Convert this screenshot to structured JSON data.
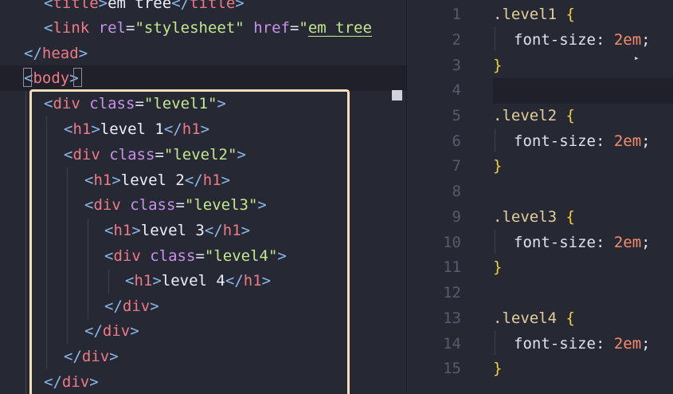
{
  "html_editor": {
    "lines": [
      [
        {
          "t": "<",
          "c": "punc"
        },
        {
          "t": "title",
          "c": "tag"
        },
        {
          "t": ">",
          "c": "punc"
        },
        {
          "t": "em tree",
          "c": "text"
        },
        {
          "t": "</",
          "c": "punc"
        },
        {
          "t": "title",
          "c": "tag"
        },
        {
          "t": ">",
          "c": "punc"
        }
      ],
      [
        {
          "t": "<",
          "c": "punc"
        },
        {
          "t": "link",
          "c": "tag"
        },
        {
          "t": " ",
          "c": "text"
        },
        {
          "t": "rel",
          "c": "attr"
        },
        {
          "t": "=",
          "c": "eq"
        },
        {
          "t": "\"stylesheet\"",
          "c": "str"
        },
        {
          "t": " ",
          "c": "text"
        },
        {
          "t": "href",
          "c": "attr"
        },
        {
          "t": "=",
          "c": "eq"
        },
        {
          "t": "\"",
          "c": "str"
        },
        {
          "t": "em_tree",
          "c": "str underline"
        }
      ],
      [
        {
          "t": "</",
          "c": "punc"
        },
        {
          "t": "head",
          "c": "tag"
        },
        {
          "t": ">",
          "c": "punc"
        }
      ],
      [
        {
          "t": "<",
          "c": "punc"
        },
        {
          "t": "body",
          "c": "tag"
        },
        {
          "t": ">",
          "c": "punc"
        }
      ],
      [
        {
          "t": "<",
          "c": "punc"
        },
        {
          "t": "div",
          "c": "tag"
        },
        {
          "t": " ",
          "c": "text"
        },
        {
          "t": "class",
          "c": "attr"
        },
        {
          "t": "=",
          "c": "eq"
        },
        {
          "t": "\"level1\"",
          "c": "str"
        },
        {
          "t": ">",
          "c": "punc"
        }
      ],
      [
        {
          "t": "<",
          "c": "punc"
        },
        {
          "t": "h1",
          "c": "tag"
        },
        {
          "t": ">",
          "c": "punc"
        },
        {
          "t": "level 1",
          "c": "text"
        },
        {
          "t": "</",
          "c": "punc"
        },
        {
          "t": "h1",
          "c": "tag"
        },
        {
          "t": ">",
          "c": "punc"
        }
      ],
      [
        {
          "t": "<",
          "c": "punc"
        },
        {
          "t": "div",
          "c": "tag"
        },
        {
          "t": " ",
          "c": "text"
        },
        {
          "t": "class",
          "c": "attr"
        },
        {
          "t": "=",
          "c": "eq"
        },
        {
          "t": "\"level2\"",
          "c": "str"
        },
        {
          "t": ">",
          "c": "punc"
        }
      ],
      [
        {
          "t": "<",
          "c": "punc"
        },
        {
          "t": "h1",
          "c": "tag"
        },
        {
          "t": ">",
          "c": "punc"
        },
        {
          "t": "level 2",
          "c": "text"
        },
        {
          "t": "</",
          "c": "punc"
        },
        {
          "t": "h1",
          "c": "tag"
        },
        {
          "t": ">",
          "c": "punc"
        }
      ],
      [
        {
          "t": "<",
          "c": "punc"
        },
        {
          "t": "div",
          "c": "tag"
        },
        {
          "t": " ",
          "c": "text"
        },
        {
          "t": "class",
          "c": "attr"
        },
        {
          "t": "=",
          "c": "eq"
        },
        {
          "t": "\"level3\"",
          "c": "str"
        },
        {
          "t": ">",
          "c": "punc"
        }
      ],
      [
        {
          "t": "<",
          "c": "punc"
        },
        {
          "t": "h1",
          "c": "tag"
        },
        {
          "t": ">",
          "c": "punc"
        },
        {
          "t": "level 3",
          "c": "text"
        },
        {
          "t": "</",
          "c": "punc"
        },
        {
          "t": "h1",
          "c": "tag"
        },
        {
          "t": ">",
          "c": "punc"
        }
      ],
      [
        {
          "t": "<",
          "c": "punc"
        },
        {
          "t": "div",
          "c": "tag"
        },
        {
          "t": " ",
          "c": "text"
        },
        {
          "t": "class",
          "c": "attr"
        },
        {
          "t": "=",
          "c": "eq"
        },
        {
          "t": "\"level4\"",
          "c": "str"
        },
        {
          "t": ">",
          "c": "punc"
        }
      ],
      [
        {
          "t": "<",
          "c": "punc"
        },
        {
          "t": "h1",
          "c": "tag"
        },
        {
          "t": ">",
          "c": "punc"
        },
        {
          "t": "level 4",
          "c": "text"
        },
        {
          "t": "</",
          "c": "punc"
        },
        {
          "t": "h1",
          "c": "tag"
        },
        {
          "t": ">",
          "c": "punc"
        }
      ],
      [
        {
          "t": "</",
          "c": "punc"
        },
        {
          "t": "div",
          "c": "tag"
        },
        {
          "t": ">",
          "c": "punc"
        }
      ],
      [
        {
          "t": "</",
          "c": "punc"
        },
        {
          "t": "div",
          "c": "tag"
        },
        {
          "t": ">",
          "c": "punc"
        }
      ],
      [
        {
          "t": "</",
          "c": "punc"
        },
        {
          "t": "div",
          "c": "tag"
        },
        {
          "t": ">",
          "c": "punc"
        }
      ],
      [
        {
          "t": "</",
          "c": "punc"
        },
        {
          "t": "div",
          "c": "tag"
        },
        {
          "t": ">",
          "c": "punc"
        }
      ]
    ]
  },
  "css_editor": {
    "line_numbers": [
      "1",
      "2",
      "3",
      "4",
      "5",
      "6",
      "7",
      "8",
      "9",
      "10",
      "11",
      "12",
      "13",
      "14",
      "15"
    ],
    "lines": [
      [
        {
          "t": ".level1",
          "c": "selector"
        },
        {
          "t": " ",
          "c": "text"
        },
        {
          "t": "{",
          "c": "brace"
        }
      ],
      [
        {
          "t": "font-size",
          "c": "prop"
        },
        {
          "t": ": ",
          "c": "prop"
        },
        {
          "t": "2em",
          "c": "val"
        },
        {
          "t": ";",
          "c": "prop"
        }
      ],
      [
        {
          "t": "}",
          "c": "brace"
        }
      ],
      [],
      [
        {
          "t": ".level2",
          "c": "selector"
        },
        {
          "t": " ",
          "c": "text"
        },
        {
          "t": "{",
          "c": "brace"
        }
      ],
      [
        {
          "t": "font-size",
          "c": "prop"
        },
        {
          "t": ": ",
          "c": "prop"
        },
        {
          "t": "2em",
          "c": "val"
        },
        {
          "t": ";",
          "c": "prop"
        }
      ],
      [
        {
          "t": "}",
          "c": "brace"
        }
      ],
      [],
      [
        {
          "t": ".level3",
          "c": "selector"
        },
        {
          "t": " ",
          "c": "text"
        },
        {
          "t": "{",
          "c": "brace"
        }
      ],
      [
        {
          "t": "font-size",
          "c": "prop"
        },
        {
          "t": ": ",
          "c": "prop"
        },
        {
          "t": "2em",
          "c": "val"
        },
        {
          "t": ";",
          "c": "prop"
        }
      ],
      [
        {
          "t": "}",
          "c": "brace"
        }
      ],
      [],
      [
        {
          "t": ".level4",
          "c": "selector"
        },
        {
          "t": " ",
          "c": "text"
        },
        {
          "t": "{",
          "c": "brace"
        }
      ],
      [
        {
          "t": "font-size",
          "c": "prop"
        },
        {
          "t": ": ",
          "c": "prop"
        },
        {
          "t": "2em",
          "c": "val"
        },
        {
          "t": ";",
          "c": "prop"
        }
      ],
      [
        {
          "t": "}",
          "c": "brace"
        }
      ]
    ]
  },
  "cursor_icon": "mouse-pointer-icon"
}
